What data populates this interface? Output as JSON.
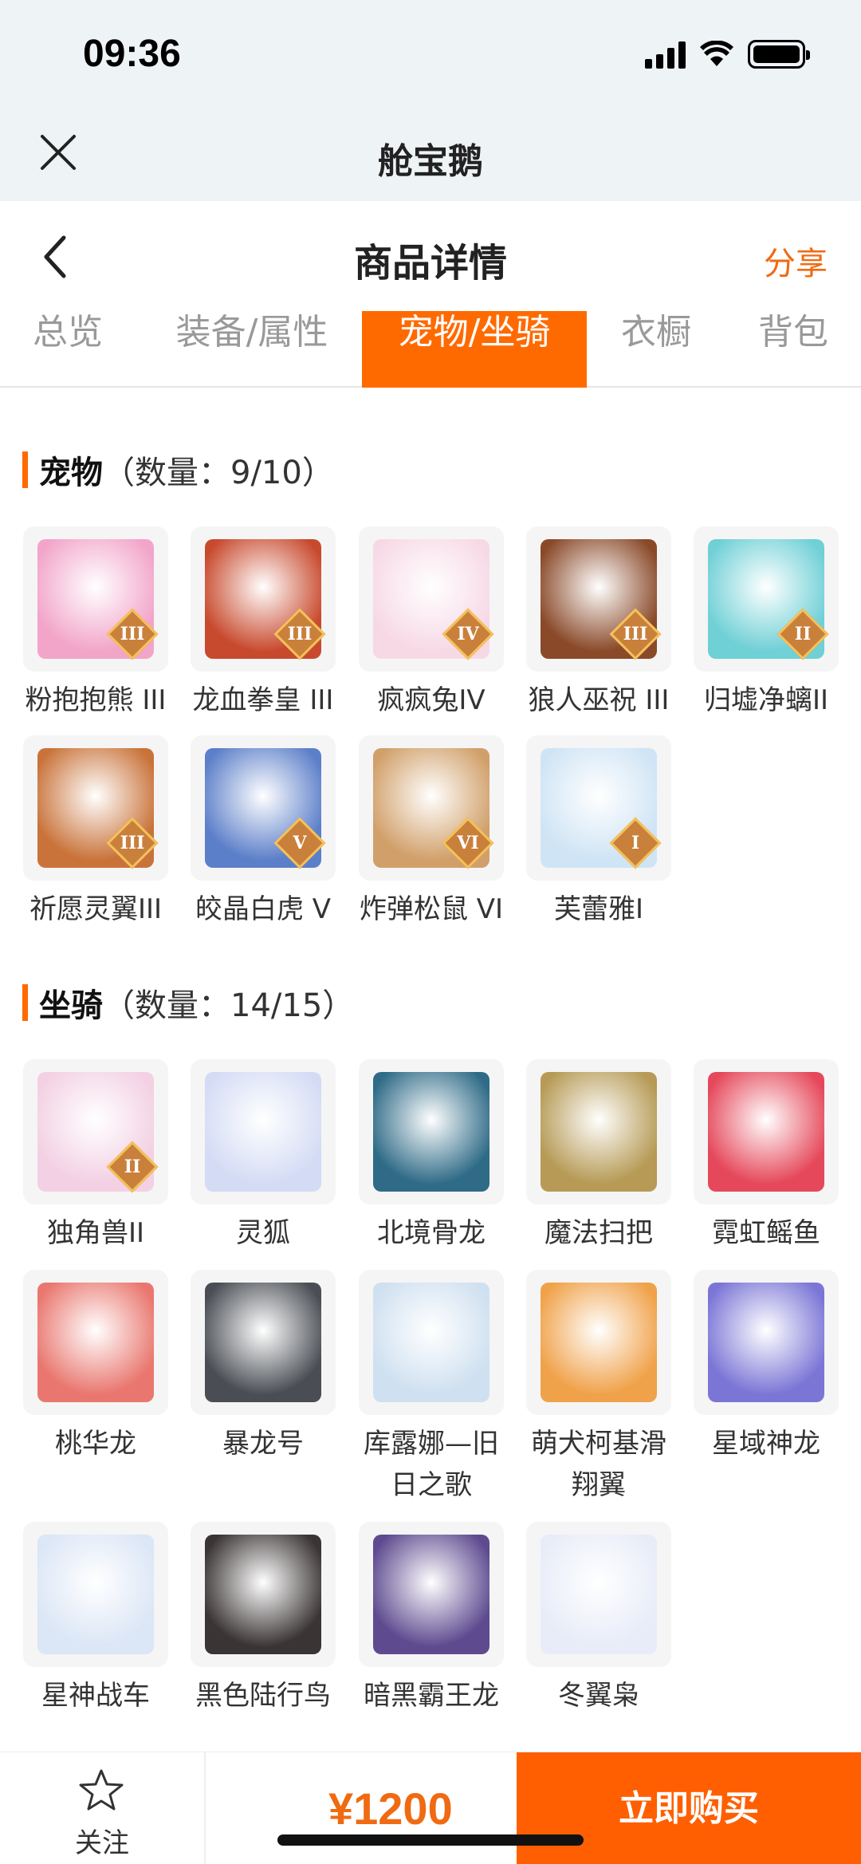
{
  "status_bar": {
    "time": "09:36"
  },
  "app_header": {
    "title": "舱宝鹅"
  },
  "page_header": {
    "title": "商品详情",
    "share_label": "分享"
  },
  "tabs": [
    {
      "label": "总览",
      "active": false
    },
    {
      "label": "装备/属性",
      "active": false
    },
    {
      "label": "宠物/坐骑",
      "active": true
    },
    {
      "label": "衣橱",
      "active": false
    },
    {
      "label": "背包",
      "active": false
    }
  ],
  "pets": {
    "title": "宠物",
    "count_label": "（数量：9/10）",
    "items": [
      {
        "name": "粉抱抱熊 III",
        "rank": "III",
        "color": "#f2a5c9"
      },
      {
        "name": "龙血拳皇 III",
        "rank": "III",
        "color": "#c84a2e"
      },
      {
        "name": "疯疯兔IV",
        "rank": "IV",
        "color": "#f7d9e6"
      },
      {
        "name": "狼人巫祝 III",
        "rank": "III",
        "color": "#8a4a2a"
      },
      {
        "name": "归墟净螭II",
        "rank": "II",
        "color": "#6fd0d6"
      },
      {
        "name": "祈愿灵翼III",
        "rank": "III",
        "color": "#c9733a"
      },
      {
        "name": "皎晶白虎 V",
        "rank": "V",
        "color": "#5c7fc9"
      },
      {
        "name": "炸弹松鼠 VI",
        "rank": "VI",
        "color": "#d1a06a"
      },
      {
        "name": "芙蕾雅I",
        "rank": "I",
        "color": "#cfe4f5"
      }
    ]
  },
  "mounts": {
    "title": "坐骑",
    "count_label": "（数量：14/15）",
    "items": [
      {
        "name": "独角兽II",
        "rank": "II",
        "color": "#f3d0e3"
      },
      {
        "name": "灵狐",
        "rank": "",
        "color": "#d4dcf5"
      },
      {
        "name": "北境骨龙",
        "rank": "",
        "color": "#2f6b87"
      },
      {
        "name": "魔法扫把",
        "rank": "",
        "color": "#b69a55"
      },
      {
        "name": "霓虹鳐鱼",
        "rank": "",
        "color": "#e5485a"
      },
      {
        "name": "桃华龙",
        "rank": "",
        "color": "#e9776f"
      },
      {
        "name": "暴龙号",
        "rank": "",
        "color": "#4a4e54"
      },
      {
        "name": "库露娜—旧日之歌",
        "rank": "",
        "color": "#cfe0f0"
      },
      {
        "name": "萌犬柯基滑翔翼",
        "rank": "",
        "color": "#f0a24a"
      },
      {
        "name": "星域神龙",
        "rank": "",
        "color": "#7b76d6"
      },
      {
        "name": "星神战车",
        "rank": "",
        "color": "#dbe6f6"
      },
      {
        "name": "黑色陆行鸟",
        "rank": "",
        "color": "#3a3434"
      },
      {
        "name": "暗黑霸王龙",
        "rank": "",
        "color": "#5d4a8f"
      },
      {
        "name": "冬翼枭",
        "rank": "",
        "color": "#e8ecf8"
      }
    ]
  },
  "bottom_bar": {
    "follow_label": "关注",
    "price": "¥1200",
    "buy_label": "立即购买"
  },
  "colors": {
    "accent": "#ff6a00",
    "share": "#f06a12",
    "rank_badge": "#c9803b"
  }
}
